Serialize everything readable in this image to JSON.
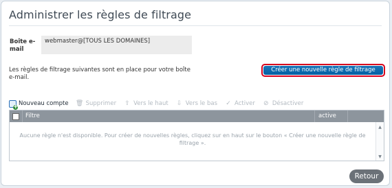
{
  "page": {
    "title": "Administrer les règles de filtrage"
  },
  "mailbox": {
    "label": "Boîte e-mail",
    "value": "webmaster@[TOUS LES DOMAINES]"
  },
  "intro_text": "Les règles de filtrage suivantes sont en place pour votre boîte e-mail.",
  "create_button": {
    "label": "Créer une nouvelle règle de filtrage",
    "highlight_color": "#d6001c",
    "color": "#0a6aaf"
  },
  "toolbar": {
    "items": [
      {
        "label": "Nouveau compte",
        "icon": "new-account-icon",
        "enabled": true
      },
      {
        "label": "Supprimer",
        "icon": "trash-icon",
        "enabled": false
      },
      {
        "label": "Vers le haut",
        "icon": "arrow-up-icon",
        "enabled": false
      },
      {
        "label": "Vers le bas",
        "icon": "arrow-down-icon",
        "enabled": false
      },
      {
        "label": "Activer",
        "icon": "check-icon",
        "enabled": false
      },
      {
        "label": "Désactiver",
        "icon": "no-icon",
        "enabled": false
      }
    ]
  },
  "grid": {
    "columns": [
      "Filtre",
      "active"
    ],
    "empty_message": "Aucune règle n'est disponible. Pour créer de nouvelles règles, cliquez sur en haut sur le bouton « Créer une nouvelle règle de filtrage »."
  },
  "return_button": {
    "label": "Retour"
  }
}
